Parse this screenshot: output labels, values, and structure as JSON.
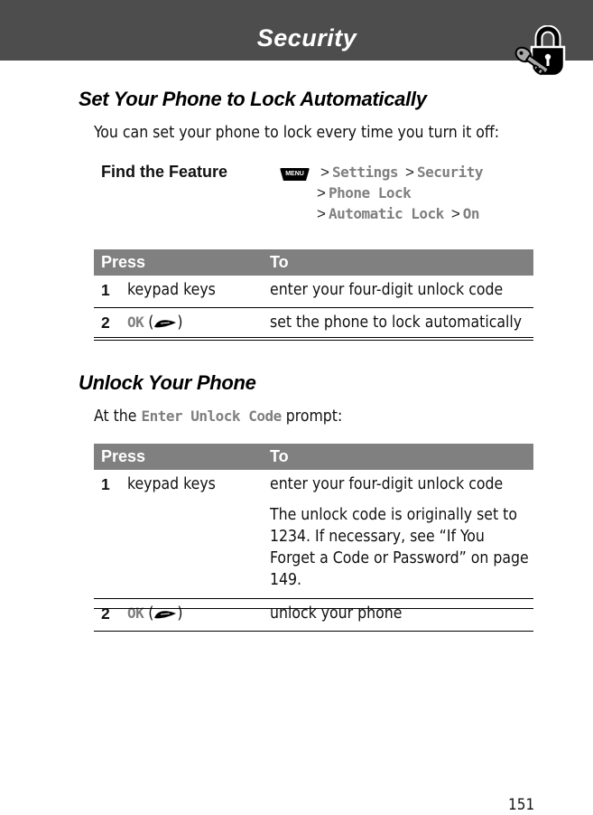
{
  "header": {
    "title": "Security",
    "icon": "lock-and-key-icon"
  },
  "section1": {
    "heading": "Set Your Phone to Lock Automatically",
    "intro": "You can set your phone to lock every time you turn it off:",
    "find_feature": {
      "label": "Find the Feature",
      "menu_key": "MENU",
      "separator": ">",
      "path": [
        "Settings",
        "Security",
        "Phone Lock",
        "Automatic Lock",
        "On"
      ]
    },
    "table": {
      "headers": [
        "Press",
        "To"
      ],
      "rows": [
        {
          "num": "1",
          "press": "keypad keys",
          "to": "enter your four-digit unlock code"
        },
        {
          "num": "2",
          "press_key": "OK",
          "press_icon": "right-soft-key-icon",
          "to": "set the phone to lock automatically"
        }
      ]
    }
  },
  "section2": {
    "heading": "Unlock Your Phone",
    "intro_before": "At the",
    "intro_prompt": "Enter Unlock Code",
    "intro_after": "prompt:",
    "table": {
      "headers": [
        "Press",
        "To"
      ],
      "rows": [
        {
          "num": "1",
          "press": "keypad keys",
          "to": "enter your four-digit unlock code",
          "note": "The unlock code is originally set to 1234. If necessary, see “If You Forget a Code or Password” on page 149."
        },
        {
          "num": "2",
          "press_key": "OK",
          "press_icon": "right-soft-key-icon",
          "to": "unlock your phone"
        }
      ]
    }
  },
  "footer": {
    "page_number": "151"
  }
}
